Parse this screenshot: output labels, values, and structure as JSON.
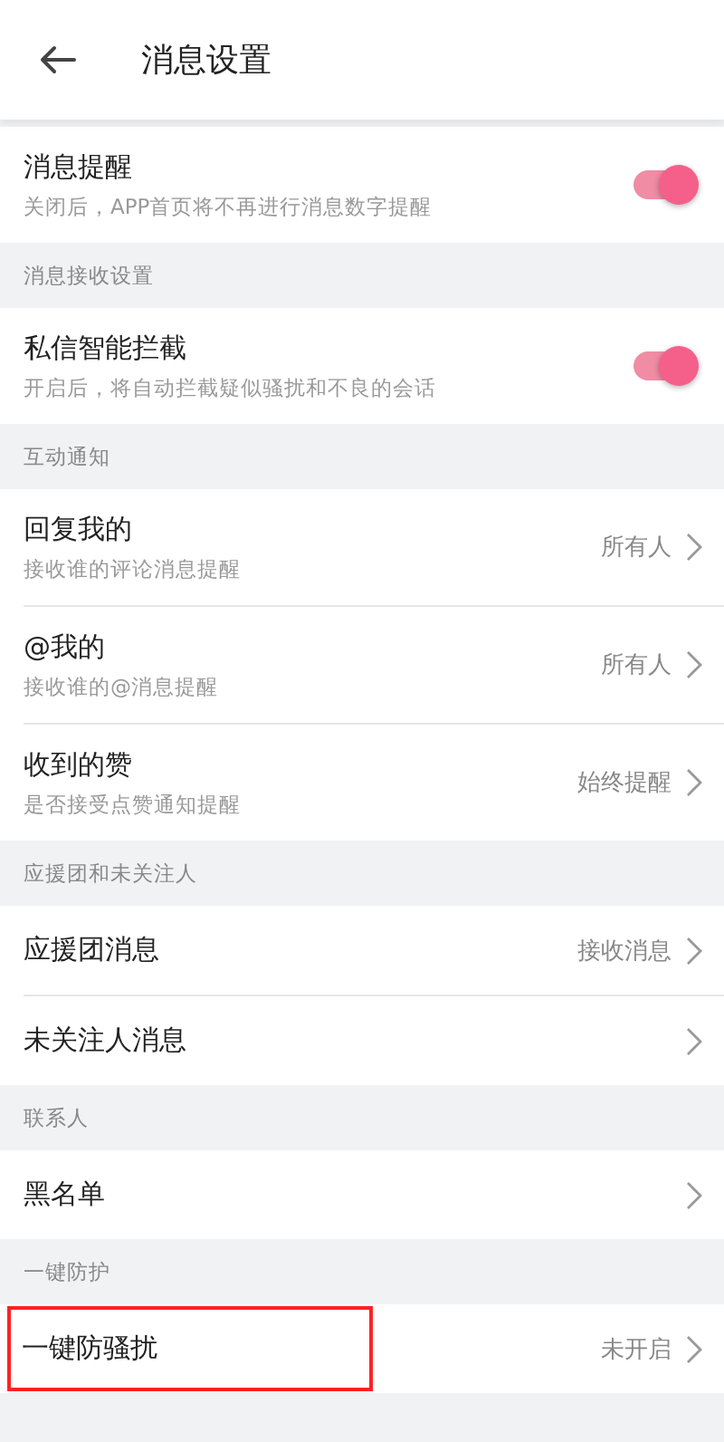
{
  "header": {
    "title": "消息设置"
  },
  "sections": [
    {
      "rows": [
        {
          "kind": "toggle",
          "title": "消息提醒",
          "subtitle": "关闭后，APP首页将不再进行消息数字提醒",
          "on": true,
          "highlighted": false
        }
      ]
    },
    {
      "heading": "消息接收设置",
      "rows": [
        {
          "kind": "toggle",
          "title": "私信智能拦截",
          "subtitle": "开启后，将自动拦截疑似骚扰和不良的会话",
          "on": true,
          "highlighted": false
        }
      ]
    },
    {
      "heading": "互动通知",
      "rows": [
        {
          "kind": "link",
          "title": "回复我的",
          "subtitle": "接收谁的评论消息提醒",
          "value": "所有人",
          "highlighted": false
        },
        {
          "kind": "link",
          "title": "@我的",
          "subtitle": "接收谁的@消息提醒",
          "value": "所有人",
          "highlighted": false
        },
        {
          "kind": "link",
          "title": "收到的赞",
          "subtitle": "是否接受点赞通知提醒",
          "value": "始终提醒",
          "highlighted": false
        }
      ]
    },
    {
      "heading": "应援团和未关注人",
      "rows": [
        {
          "kind": "link",
          "title": "应援团消息",
          "value": "接收消息",
          "highlighted": false
        },
        {
          "kind": "link",
          "title": "未关注人消息",
          "highlighted": false
        }
      ]
    },
    {
      "heading": "联系人",
      "rows": [
        {
          "kind": "link",
          "title": "黑名单",
          "highlighted": false
        }
      ]
    },
    {
      "heading": "一键防护",
      "rows": [
        {
          "kind": "link",
          "title": "一键防骚扰",
          "value": "未开启",
          "highlighted": true
        }
      ]
    }
  ]
}
